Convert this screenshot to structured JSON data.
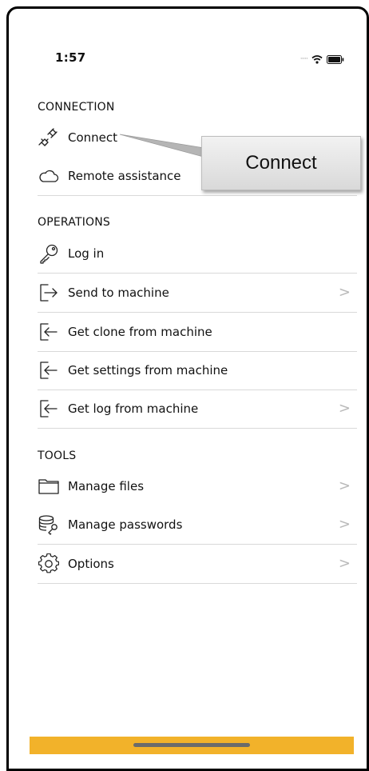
{
  "status_bar": {
    "time": "1:57",
    "signal_icon": "signal-dots-icon",
    "wifi_icon": "wifi-icon",
    "battery_icon": "battery-icon"
  },
  "sections": {
    "connection": {
      "title": "CONNECTION",
      "items": [
        {
          "label": "Connect",
          "icon": "plug-icon",
          "chevron": false
        },
        {
          "label": "Remote assistance",
          "icon": "cloud-icon",
          "chevron": false
        }
      ]
    },
    "operations": {
      "title": "OPERATIONS",
      "items": [
        {
          "label": "Log in",
          "icon": "key-icon",
          "chevron": false
        },
        {
          "label": "Send to machine",
          "icon": "send-icon",
          "chevron": true
        },
        {
          "label": "Get clone from machine",
          "icon": "receive-icon",
          "chevron": false
        },
        {
          "label": "Get settings from machine",
          "icon": "receive-icon",
          "chevron": false
        },
        {
          "label": "Get log from machine",
          "icon": "receive-icon",
          "chevron": true
        }
      ]
    },
    "tools": {
      "title": "TOOLS",
      "items": [
        {
          "label": "Manage files",
          "icon": "folder-icon",
          "chevron": true
        },
        {
          "label": "Manage passwords",
          "icon": "database-key-icon",
          "chevron": true
        },
        {
          "label": "Options",
          "icon": "gear-icon",
          "chevron": true
        }
      ]
    }
  },
  "chevron_glyph": ">",
  "tooltip": {
    "text": "Connect"
  },
  "colors": {
    "home_band": "#f2b22a",
    "divider": "#d9d9d9",
    "chevron": "#b9b9b9"
  }
}
